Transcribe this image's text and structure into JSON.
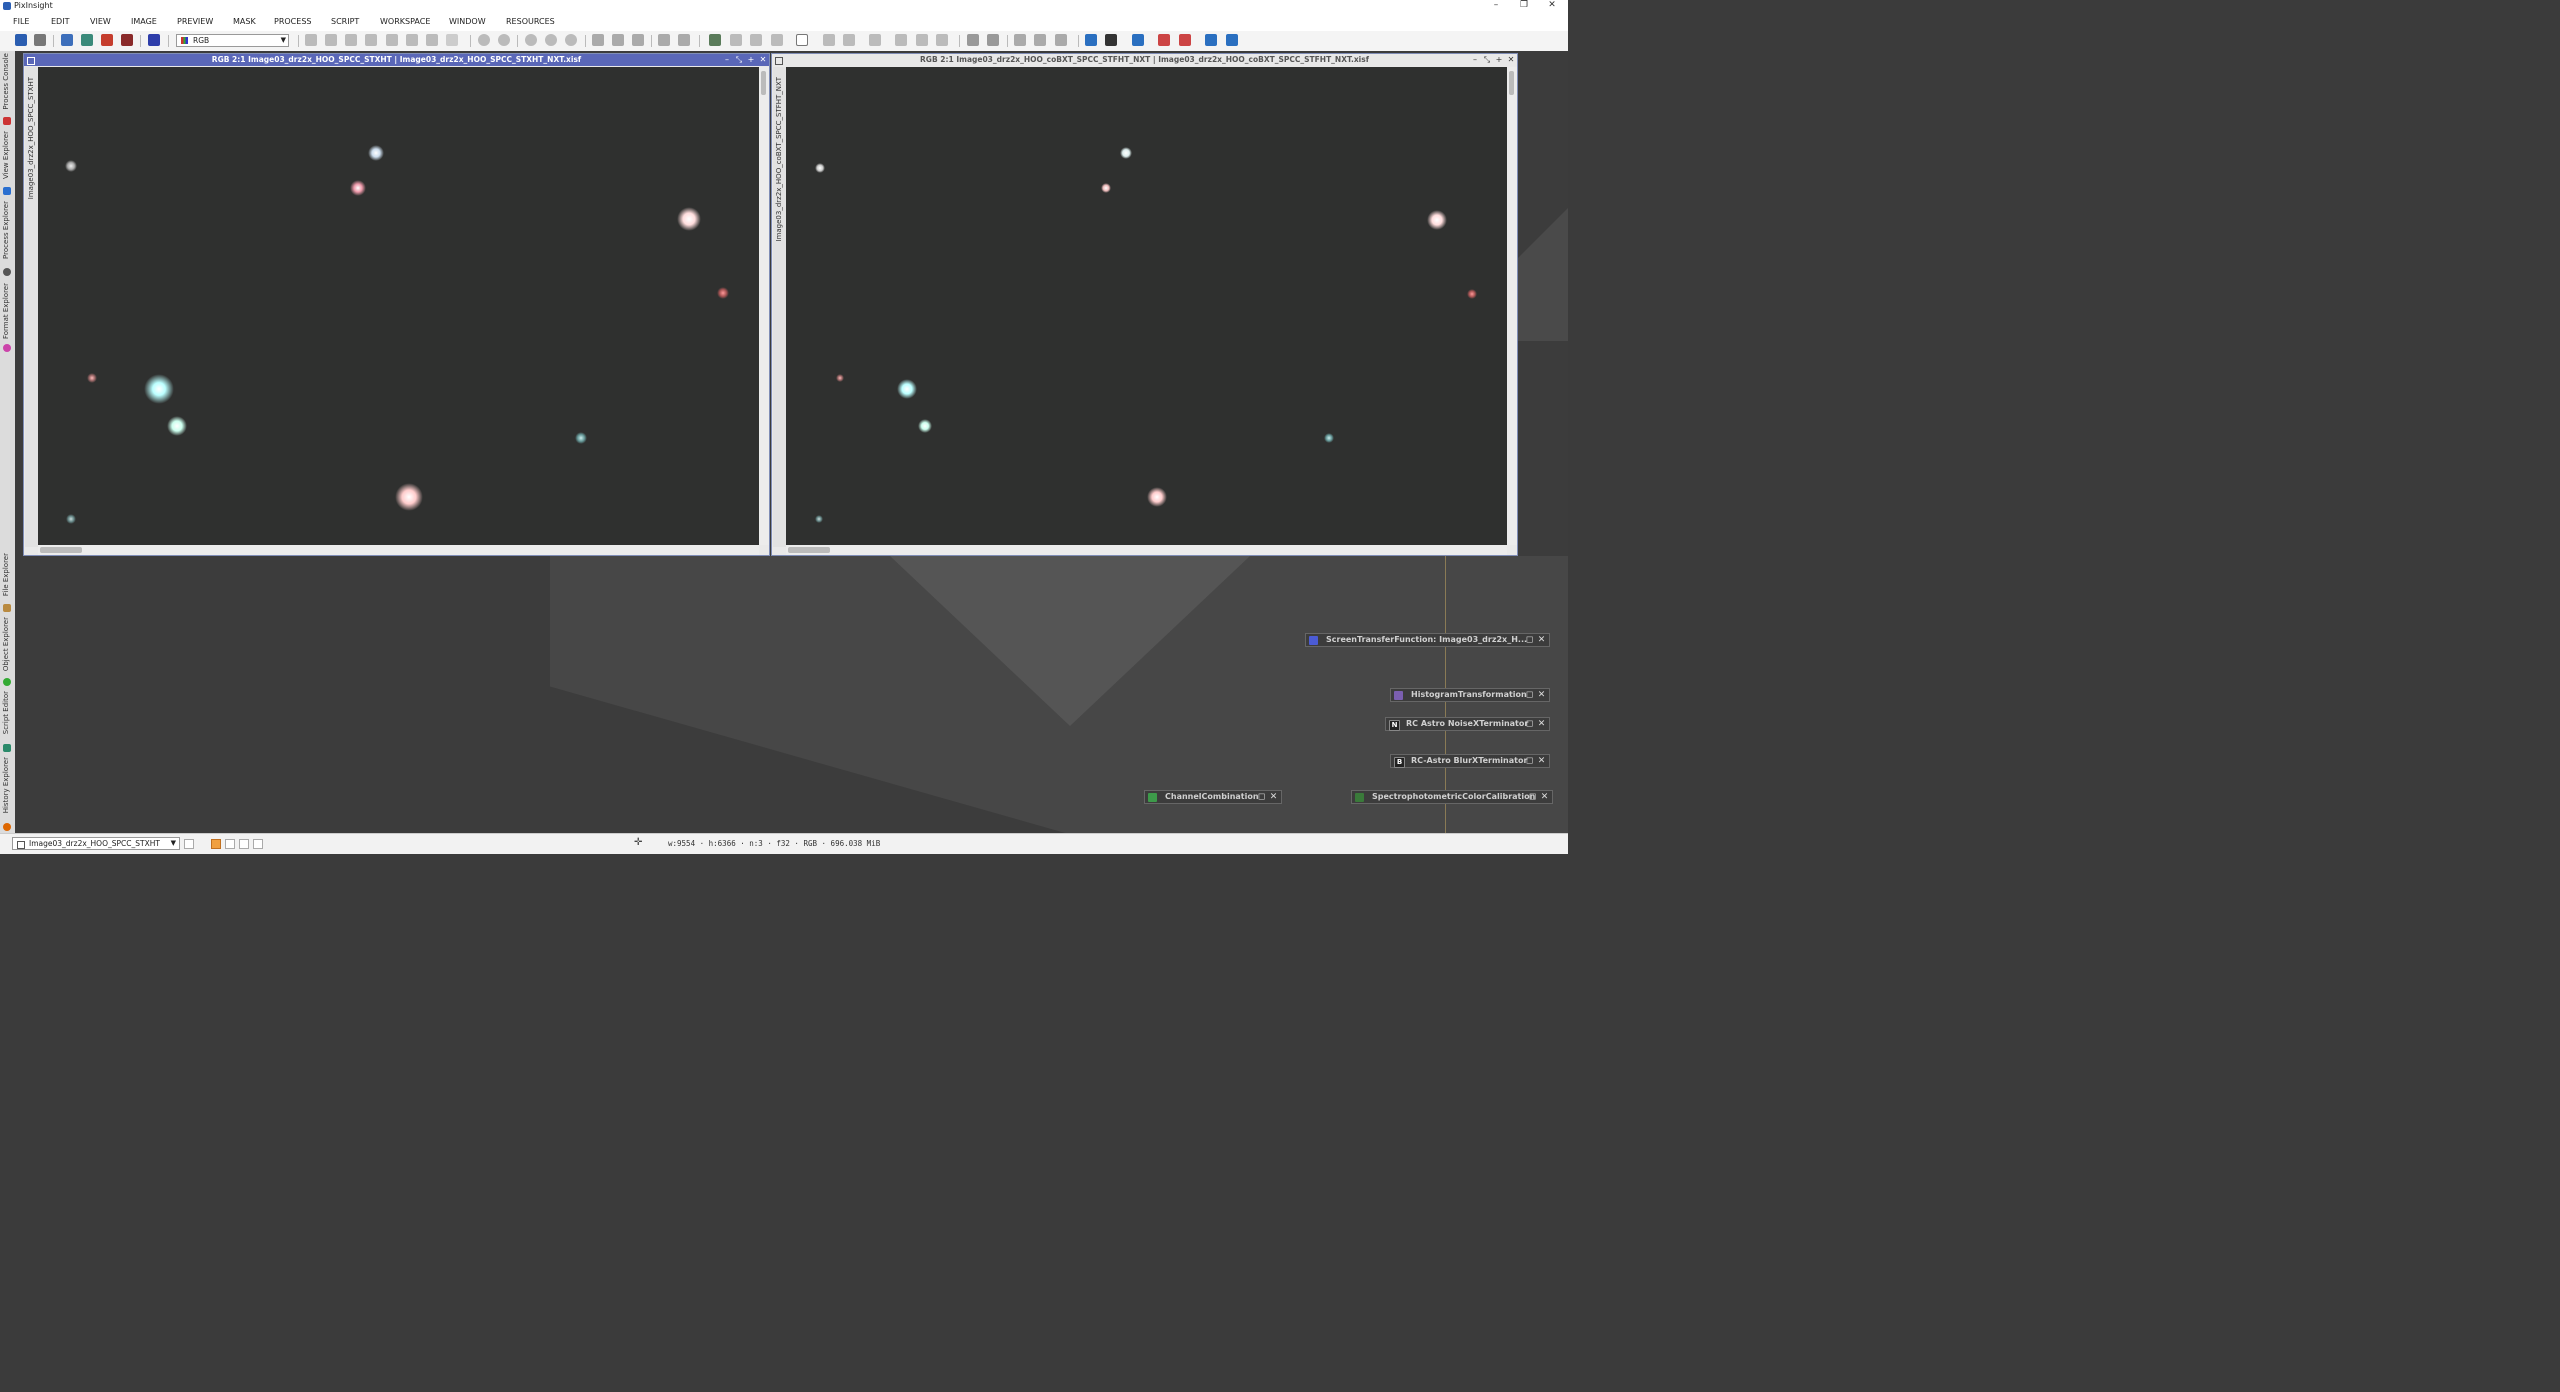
{
  "app": {
    "title": "PixInsight"
  },
  "menubar": [
    "FILE",
    "EDIT",
    "VIEW",
    "IMAGE",
    "PREVIEW",
    "MASK",
    "PROCESS",
    "SCRIPT",
    "WORKSPACE",
    "WINDOW",
    "RESOURCES"
  ],
  "toolbar": {
    "channel_value": "RGB"
  },
  "sidebar_top": [
    "Process Console",
    "View Explorer",
    "Process Explorer",
    "Format Explorer"
  ],
  "sidebar_bottom": [
    "File Explorer",
    "Object Explorer",
    "Script Editor",
    "History Explorer"
  ],
  "windows": [
    {
      "title": "RGB 2:1 Image03_drz2x_HOO_SPCC_STXHT | Image03_drz2x_HOO_SPCC_STXHT_NXT.xisf",
      "tab_label": "Image03_drz2x_HOO_SPCC_STXHT",
      "active": true
    },
    {
      "title": "RGB 2:1 Image03_drz2x_HOO_coBXT_SPCC_STFHT_NXT | Image03_drz2x_HOO_coBXT_SPCC_STFHT_NXT.xisf",
      "tab_label": "Image03_drz2x_HOO_coBXT_SPCC_STFHT_NXT",
      "active": false
    }
  ],
  "process_icons": [
    {
      "label": "ScreenTransferFunction: Image03_drz2x_H...",
      "icon": "stf-icon",
      "color": "#4b5bd4"
    },
    {
      "label": "HistogramTransformation",
      "icon": "histogram-icon",
      "color": "#7b5fb0"
    },
    {
      "label": "RC Astro NoiseXTerminator",
      "icon": "noisexterminator-icon",
      "letter": "N",
      "color": "#222222"
    },
    {
      "label": "RC-Astro BlurXTerminator",
      "icon": "blurxterminator-icon",
      "letter": "B",
      "color": "#222222"
    },
    {
      "label": "ChannelCombination",
      "icon": "channelcombination-icon",
      "color": "#3d9a4a"
    },
    {
      "label": "SpectrophotometricColorCalibration",
      "icon": "spcc-icon",
      "color": "#3a7a3a"
    }
  ],
  "statusbar": {
    "view": "Image03_drz2x_HOO_SPCC_STXHT",
    "info": "w:9554 · h:6366 · n:3 · f32 · RGB · 696.038 MiB"
  },
  "colors": {
    "active_title": "#5a67b8",
    "workspace": "#3c3c3c"
  }
}
